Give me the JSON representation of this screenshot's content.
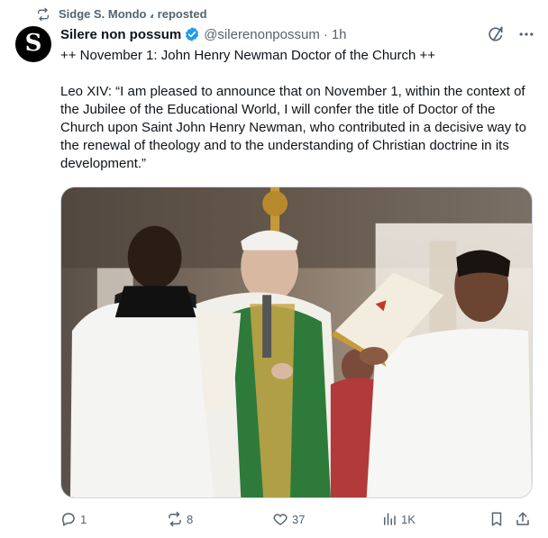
{
  "repost": {
    "icon": "repost-icon",
    "label": "Sidge S. Mondo ، reposted"
  },
  "author": {
    "avatar_letter": "S",
    "name": "Silere non possum",
    "handle": "@silerenonpossum",
    "separator": "·",
    "time": "1h",
    "verified": true
  },
  "tweet": {
    "line1": "++ November 1: John Henry Newman Doctor of the Church ++",
    "line2": "Leo XIV: “I am pleased to announce that on November 1, within the context of the Jubilee of the Educational World, I will confer the title of Doctor of the Church upon Saint John Henry Newman, who contributed in a decisive way to the renewal of theology and to the understanding of Christian doctrine in its development.”"
  },
  "actions": {
    "reply": {
      "icon": "reply-icon",
      "count": "1"
    },
    "repost": {
      "icon": "repost-icon",
      "count": "8"
    },
    "like": {
      "icon": "heart-icon",
      "count": "37"
    },
    "views": {
      "icon": "views-icon",
      "count": "1K"
    },
    "bookmark": {
      "icon": "bookmark-icon"
    },
    "share": {
      "icon": "share-icon"
    }
  },
  "colors": {
    "text": "#0f1419",
    "muted": "#536471",
    "verified": "#1d9bf0"
  }
}
